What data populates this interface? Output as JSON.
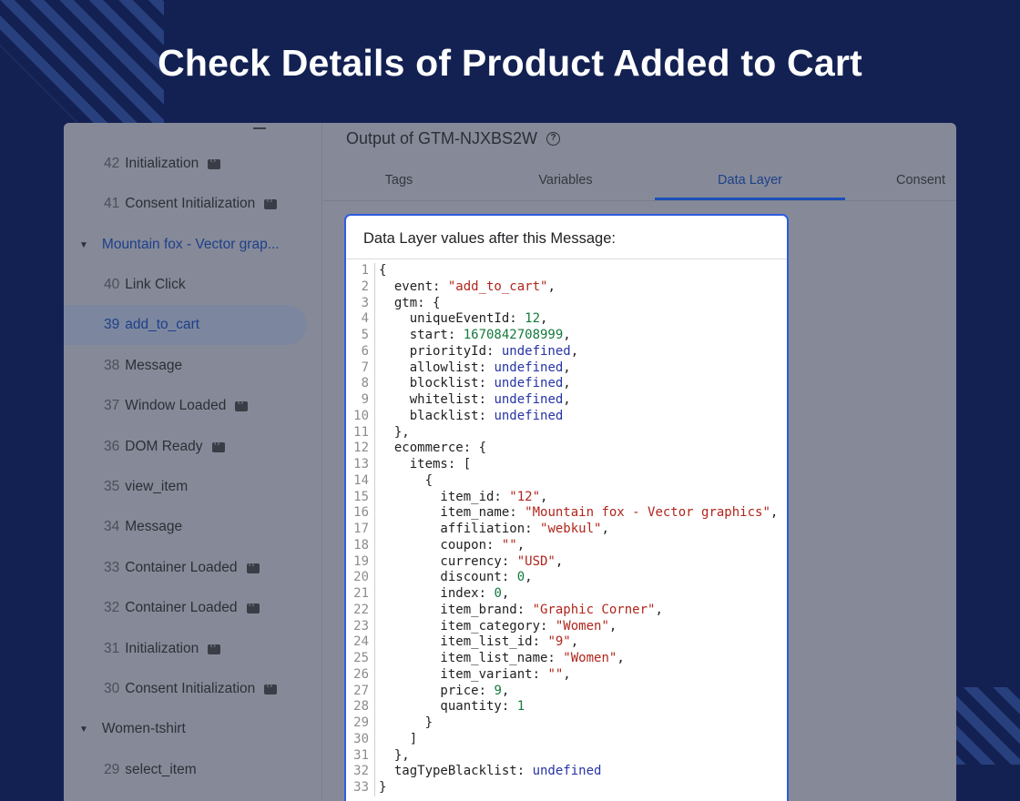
{
  "headline": "Check Details of Product Added to Cart",
  "panel": {
    "title": "Output of GTM-NJXBS2W",
    "tabs": [
      "Tags",
      "Variables",
      "Data Layer",
      "Consent"
    ],
    "active_tab": "Data Layer",
    "card_title": "Data Layer values after this Message:"
  },
  "sidebar": {
    "items": [
      {
        "num": "42",
        "label": "Initialization",
        "icon": "code-icon"
      },
      {
        "num": "41",
        "label": "Consent Initialization",
        "icon": "code-icon"
      },
      {
        "group": true,
        "label": "Mountain fox - Vector grap..."
      },
      {
        "num": "40",
        "label": "Link Click"
      },
      {
        "num": "39",
        "label": "add_to_cart",
        "selected": true
      },
      {
        "num": "38",
        "label": "Message"
      },
      {
        "num": "37",
        "label": "Window Loaded",
        "icon": "code-icon"
      },
      {
        "num": "36",
        "label": "DOM Ready",
        "icon": "code-icon"
      },
      {
        "num": "35",
        "label": "view_item"
      },
      {
        "num": "34",
        "label": "Message"
      },
      {
        "num": "33",
        "label": "Container Loaded",
        "icon": "code-icon"
      },
      {
        "num": "32",
        "label": "Container Loaded",
        "icon": "code-icon"
      },
      {
        "num": "31",
        "label": "Initialization",
        "icon": "code-icon"
      },
      {
        "num": "30",
        "label": "Consent Initialization",
        "icon": "code-icon"
      },
      {
        "group": true,
        "label": "Women-tshirt"
      },
      {
        "num": "29",
        "label": "select_item"
      }
    ]
  },
  "code_lines": [
    [
      [
        "p",
        "{"
      ]
    ],
    [
      [
        "k",
        "  event: "
      ],
      [
        "s",
        "\"add_to_cart\""
      ],
      [
        "p",
        ","
      ]
    ],
    [
      [
        "k",
        "  gtm: {"
      ]
    ],
    [
      [
        "k",
        "    uniqueEventId: "
      ],
      [
        "n",
        "12"
      ],
      [
        "p",
        ","
      ]
    ],
    [
      [
        "k",
        "    start: "
      ],
      [
        "n",
        "1670842708999"
      ],
      [
        "p",
        ","
      ]
    ],
    [
      [
        "k",
        "    priorityId: "
      ],
      [
        "u",
        "undefined"
      ],
      [
        "p",
        ","
      ]
    ],
    [
      [
        "k",
        "    allowlist: "
      ],
      [
        "u",
        "undefined"
      ],
      [
        "p",
        ","
      ]
    ],
    [
      [
        "k",
        "    blocklist: "
      ],
      [
        "u",
        "undefined"
      ],
      [
        "p",
        ","
      ]
    ],
    [
      [
        "k",
        "    whitelist: "
      ],
      [
        "u",
        "undefined"
      ],
      [
        "p",
        ","
      ]
    ],
    [
      [
        "k",
        "    blacklist: "
      ],
      [
        "u",
        "undefined"
      ]
    ],
    [
      [
        "p",
        "  },"
      ]
    ],
    [
      [
        "k",
        "  ecommerce: {"
      ]
    ],
    [
      [
        "k",
        "    items: ["
      ]
    ],
    [
      [
        "p",
        "      {"
      ]
    ],
    [
      [
        "k",
        "        item_id: "
      ],
      [
        "s",
        "\"12\""
      ],
      [
        "p",
        ","
      ]
    ],
    [
      [
        "k",
        "        item_name: "
      ],
      [
        "s",
        "\"Mountain fox - Vector graphics\""
      ],
      [
        "p",
        ","
      ]
    ],
    [
      [
        "k",
        "        affiliation: "
      ],
      [
        "s",
        "\"webkul\""
      ],
      [
        "p",
        ","
      ]
    ],
    [
      [
        "k",
        "        coupon: "
      ],
      [
        "s",
        "\"\""
      ],
      [
        "p",
        ","
      ]
    ],
    [
      [
        "k",
        "        currency: "
      ],
      [
        "s",
        "\"USD\""
      ],
      [
        "p",
        ","
      ]
    ],
    [
      [
        "k",
        "        discount: "
      ],
      [
        "n",
        "0"
      ],
      [
        "p",
        ","
      ]
    ],
    [
      [
        "k",
        "        index: "
      ],
      [
        "n",
        "0"
      ],
      [
        "p",
        ","
      ]
    ],
    [
      [
        "k",
        "        item_brand: "
      ],
      [
        "s",
        "\"Graphic Corner\""
      ],
      [
        "p",
        ","
      ]
    ],
    [
      [
        "k",
        "        item_category: "
      ],
      [
        "s",
        "\"Women\""
      ],
      [
        "p",
        ","
      ]
    ],
    [
      [
        "k",
        "        item_list_id: "
      ],
      [
        "s",
        "\"9\""
      ],
      [
        "p",
        ","
      ]
    ],
    [
      [
        "k",
        "        item_list_name: "
      ],
      [
        "s",
        "\"Women\""
      ],
      [
        "p",
        ","
      ]
    ],
    [
      [
        "k",
        "        item_variant: "
      ],
      [
        "s",
        "\"\""
      ],
      [
        "p",
        ","
      ]
    ],
    [
      [
        "k",
        "        price: "
      ],
      [
        "n",
        "9"
      ],
      [
        "p",
        ","
      ]
    ],
    [
      [
        "k",
        "        quantity: "
      ],
      [
        "n",
        "1"
      ]
    ],
    [
      [
        "p",
        "      }"
      ]
    ],
    [
      [
        "p",
        "    ]"
      ]
    ],
    [
      [
        "p",
        "  },"
      ]
    ],
    [
      [
        "k",
        "  tagTypeBlacklist: "
      ],
      [
        "u",
        "undefined"
      ]
    ],
    [
      [
        "p",
        "}"
      ]
    ]
  ]
}
